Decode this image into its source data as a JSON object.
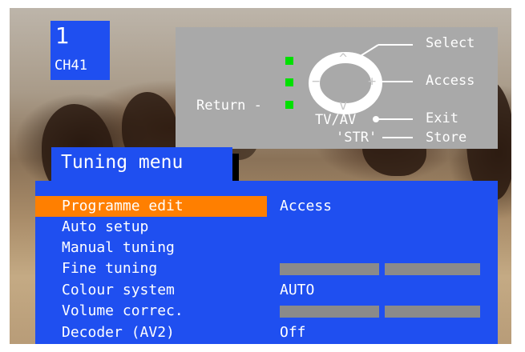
{
  "channel": {
    "number": "1",
    "name": "CH41"
  },
  "remote_help": {
    "select": "Select",
    "access": "Access",
    "exit": "Exit",
    "store": "Store",
    "return": "Return -",
    "tv_av": "TV/AV",
    "str": "'STR'",
    "up": "^",
    "down": "v",
    "minus": "−",
    "plus": "+"
  },
  "menu": {
    "title": "Tuning menu",
    "items": [
      {
        "label": "Programme edit",
        "value": "Access",
        "selected": true
      },
      {
        "label": "Auto setup",
        "value": ""
      },
      {
        "label": "Manual tuning",
        "value": ""
      },
      {
        "label": "Fine tuning",
        "value": "",
        "bar": true
      },
      {
        "label": "Colour system",
        "value": "AUTO"
      },
      {
        "label": "Volume correc.",
        "value": "",
        "bar": true
      },
      {
        "label": "Decoder (AV2)",
        "value": "Off"
      }
    ]
  },
  "colors": {
    "menu_bg": "#1f4ff0",
    "highlight": "#ff7f00",
    "help_bg": "#a9a9a9",
    "indicator": "#00e000"
  }
}
